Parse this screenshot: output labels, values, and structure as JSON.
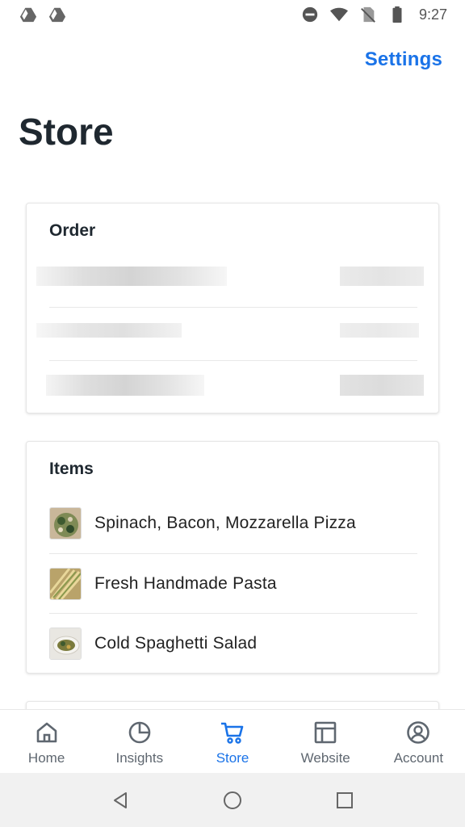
{
  "status_bar": {
    "time": "9:27",
    "left_icons": [
      "drive-icon",
      "drive-icon"
    ],
    "right_icons": [
      "do-not-disturb-icon",
      "wifi-icon",
      "no-sim-icon",
      "battery-icon"
    ]
  },
  "header": {
    "settings_label": "Settings",
    "title": "Store"
  },
  "order_card": {
    "title": "Order",
    "rows": [
      {
        "state": "loading"
      },
      {
        "state": "loading"
      },
      {
        "state": "loading"
      }
    ]
  },
  "items_card": {
    "title": "Items",
    "items": [
      {
        "name": "Spinach, Bacon, Mozzarella Pizza",
        "thumb": "pizza-thumbnail"
      },
      {
        "name": "Fresh Handmade Pasta",
        "thumb": "pasta-thumbnail"
      },
      {
        "name": "Cold Spaghetti Salad",
        "thumb": "salad-thumbnail"
      }
    ]
  },
  "bottom_nav": {
    "items": [
      {
        "label": "Home",
        "icon": "home-icon",
        "active": false
      },
      {
        "label": "Insights",
        "icon": "pie-chart-icon",
        "active": false
      },
      {
        "label": "Store",
        "icon": "cart-icon",
        "active": true
      },
      {
        "label": "Website",
        "icon": "website-icon",
        "active": false
      },
      {
        "label": "Account",
        "icon": "account-icon",
        "active": false
      }
    ]
  },
  "system_nav": [
    "back-icon",
    "home-circle-icon",
    "recents-icon"
  ],
  "colors": {
    "accent": "#1a73e8",
    "title": "#1f2830",
    "nav_inactive": "#5f6770"
  }
}
